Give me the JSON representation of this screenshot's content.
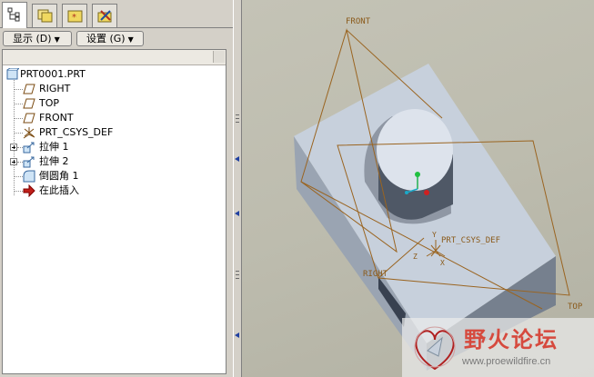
{
  "toolbar": {
    "display_label": "显示 (D)",
    "settings_label": "设置 (G)"
  },
  "model_tree": {
    "root": "PRT0001.PRT",
    "items": [
      {
        "label": "RIGHT",
        "icon": "datum-plane-icon",
        "expandable": false
      },
      {
        "label": "TOP",
        "icon": "datum-plane-icon",
        "expandable": false
      },
      {
        "label": "FRONT",
        "icon": "datum-plane-icon",
        "expandable": false
      },
      {
        "label": "PRT_CSYS_DEF",
        "icon": "coordinate-system-icon",
        "expandable": false
      },
      {
        "label": "拉伸 1",
        "icon": "extrude-icon",
        "expandable": true
      },
      {
        "label": "拉伸 2",
        "icon": "extrude-icon",
        "expandable": true
      },
      {
        "label": "倒圆角 1",
        "icon": "round-icon",
        "expandable": false
      },
      {
        "label": "在此插入",
        "icon": "insert-here-arrow-icon",
        "expandable": false
      }
    ]
  },
  "viewport": {
    "labels": {
      "front": "FRONT",
      "right": "RIGHT",
      "top": "TOP",
      "csys": "PRT_CSYS_DEF",
      "axis_x": "X",
      "axis_y": "Y",
      "axis_z": "Z"
    },
    "colors": {
      "datum": "#9a6420",
      "part": "#b4bfce"
    }
  },
  "watermark": {
    "title": "野火论坛",
    "url": "www.proewildfire.cn"
  }
}
